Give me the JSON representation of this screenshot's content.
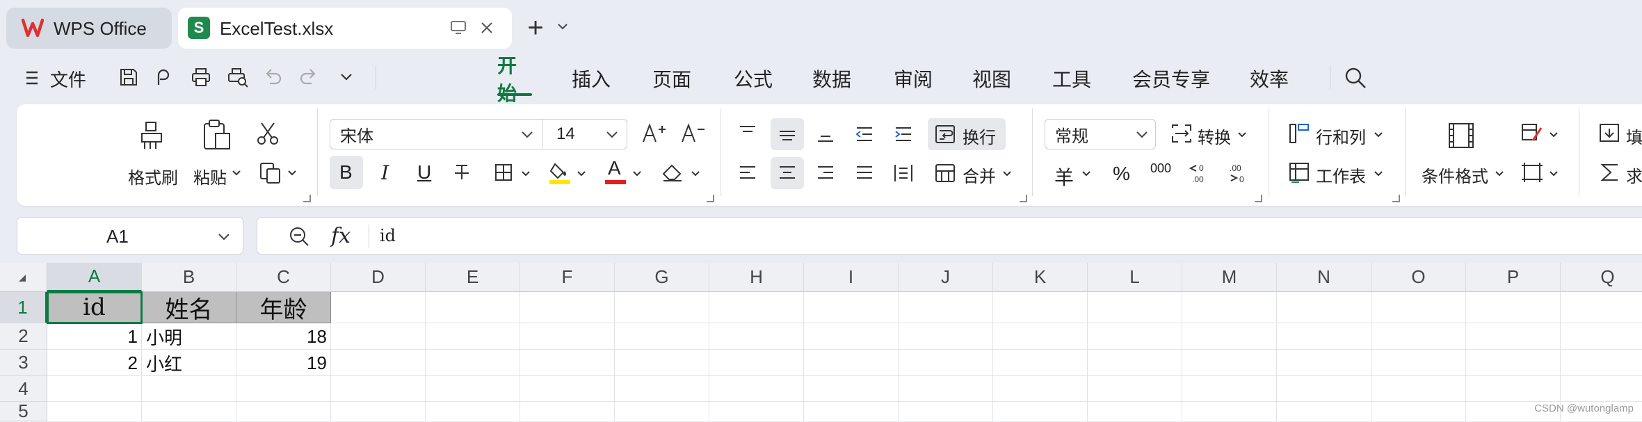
{
  "tabs": {
    "app_label": "WPS Office",
    "file_label": "ExcelTest.xlsx",
    "file_icon_letter": "S",
    "new_tab_symbol": "+"
  },
  "toolbar": {
    "file_menu_label": "文件"
  },
  "menu": {
    "items": [
      "开始",
      "插入",
      "页面",
      "公式",
      "数据",
      "审阅",
      "视图",
      "工具",
      "会员专享",
      "效率"
    ],
    "active_index": 0
  },
  "ribbon": {
    "format_painter": "格式刷",
    "paste": "粘贴",
    "font_name": "宋体",
    "font_size": "14",
    "wrap_text": "换行",
    "merge": "合并",
    "number_format": "常规",
    "convert": "转换",
    "rows_cols": "行和列",
    "worksheet": "工作表",
    "conditional_format": "条件格式",
    "fill": "填",
    "sum": "求",
    "bold_glyph": "B",
    "italic_glyph": "I",
    "underline_glyph": "U",
    "currency_glyph": "羊",
    "percent_glyph": "%",
    "thousands_glyph": "000",
    "font_color_glyph": "A"
  },
  "formula_bar": {
    "name_box": "A1",
    "fx_label": "fx",
    "content": "id"
  },
  "sheet": {
    "columns": [
      "A",
      "B",
      "C",
      "D",
      "E",
      "F",
      "G",
      "H",
      "I",
      "J",
      "K",
      "L",
      "M",
      "N",
      "O",
      "P",
      "Q"
    ],
    "rows": [
      "1",
      "2",
      "3",
      "4",
      "5"
    ],
    "selected_cell": "A1",
    "header_row": [
      "id",
      "姓名",
      "年龄"
    ],
    "data_rows": [
      {
        "id": "1",
        "name": "小明",
        "age": "18"
      },
      {
        "id": "2",
        "name": "小红",
        "age": "19"
      }
    ]
  },
  "colors": {
    "accent": "#0e7a43",
    "header_fill": "#bfbfbf",
    "highlight_yellow": "#ffe600",
    "font_red": "#e02020",
    "wps_red": "#e0302e",
    "sheet_green": "#1f8a4c"
  },
  "watermark": "CSDN @wutonglamp"
}
